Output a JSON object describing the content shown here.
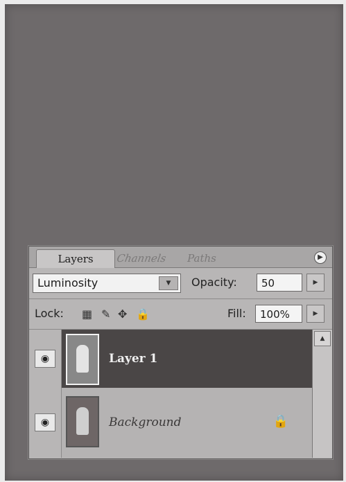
{
  "tabs": {
    "layers": "Layers",
    "channels": "Channels",
    "paths": "Paths"
  },
  "blend_mode": {
    "value": "Luminosity"
  },
  "opacity": {
    "label": "Opacity:",
    "value": "50"
  },
  "lock": {
    "label": "Lock:"
  },
  "fill": {
    "label": "Fill:",
    "value": "100%"
  },
  "layers": [
    {
      "name": "Layer 1",
      "selected": true,
      "visible": true
    },
    {
      "name": "Background",
      "selected": false,
      "visible": true,
      "locked": true
    }
  ],
  "icons": {
    "menu": "flyout-menu-icon",
    "dropdown": "chevron-down-icon",
    "stepper": "arrow-right-icon",
    "lock_transparent": "checker-icon",
    "lock_image": "brush-icon",
    "lock_position": "move-icon",
    "lock_all": "padlock-icon",
    "eye": "eye-icon"
  },
  "colors": {
    "canvas": "#6e6a6b",
    "panel": "#b8b6b6",
    "selected_layer": "#4a4646"
  }
}
